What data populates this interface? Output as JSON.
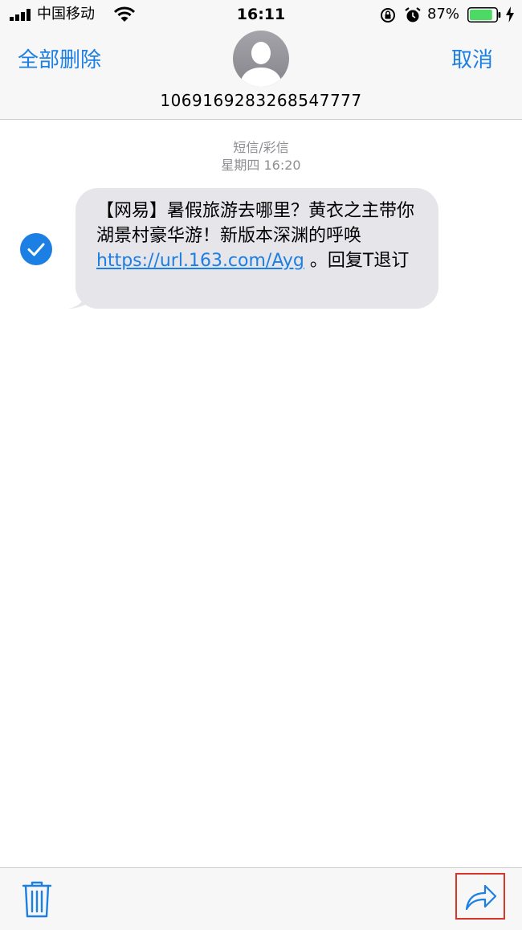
{
  "status_bar": {
    "carrier": "中国移动",
    "time": "16:11",
    "battery": "87%",
    "battery_level": 0.87
  },
  "header": {
    "delete_all_label": "全部删除",
    "cancel_label": "取消",
    "phone_number": "1069169283268547777"
  },
  "conversation": {
    "message_type": "短信/彩信",
    "timestamp": "星期四 16:20",
    "message": {
      "selected": true,
      "text_before_link": "【网易】暑假旅游去哪里？黄衣之主带你湖景村豪华游！新版本深渊的呼唤 ",
      "link": "https://url.163.com/Ayg",
      "text_after_link": " 。回复T退订"
    }
  },
  "toolbar": {
    "trash_icon": "trash-icon",
    "forward_icon": "forward-icon"
  },
  "colors": {
    "accent": "#1b7fe3",
    "bubble": "#e5e5ea",
    "highlight_border": "#d9362b",
    "battery_green": "#4cd964"
  }
}
